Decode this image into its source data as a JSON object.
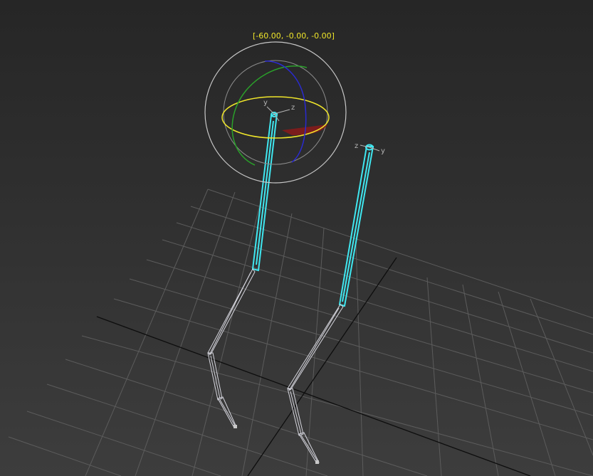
{
  "viewport": {
    "rotate_readout": "[-60.00, -0.00, -0.00]",
    "colors": {
      "background_top": "#262626",
      "background_bottom": "#3d3d3d",
      "grid": "#5a5a5a",
      "grid_axis": "#0a0a0a",
      "selected_bone": "#3fe7f0",
      "bone_wire": "#d8d8e0",
      "gizmo_x": "#2a2ad0",
      "gizmo_y": "#2aa02a",
      "gizmo_z": "#f0e62a",
      "gizmo_outer": "#c8c8c8",
      "readout": "#f0e62a"
    },
    "gizmo_axis_labels": {
      "y": "y",
      "z": "z"
    },
    "bone_axis_labels": {
      "z": "z",
      "y": "y"
    },
    "icons": [
      "rotate-gizmo-icon",
      "pivot-tripod-icon"
    ]
  }
}
